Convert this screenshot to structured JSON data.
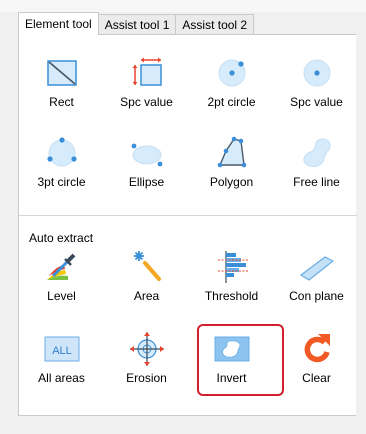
{
  "tabs": [
    "Element tool",
    "Assist tool 1",
    "Assist tool 2"
  ],
  "element_tools": [
    {
      "label": "Rect",
      "icon": "rect-icon"
    },
    {
      "label": "Spc value",
      "icon": "spc-value-rect-icon"
    },
    {
      "label": "2pt circle",
      "icon": "two-point-circle-icon"
    },
    {
      "label": "Spc value",
      "icon": "spc-value-circle-icon"
    },
    {
      "label": "3pt circle",
      "icon": "three-point-circle-icon"
    },
    {
      "label": "Ellipse",
      "icon": "ellipse-icon"
    },
    {
      "label": "Polygon",
      "icon": "polygon-icon"
    },
    {
      "label": "Free line",
      "icon": "free-line-icon"
    }
  ],
  "auto_extract": {
    "title": "Auto extract",
    "tools": [
      {
        "label": "Level",
        "icon": "level-eyedropper-icon"
      },
      {
        "label": "Area",
        "icon": "area-wand-icon"
      },
      {
        "label": "Threshold",
        "icon": "threshold-icon"
      },
      {
        "label": "Con plane",
        "icon": "con-plane-icon"
      },
      {
        "label": "All areas",
        "icon": "all-areas-icon",
        "icon_text": "ALL"
      },
      {
        "label": "Erosion",
        "icon": "erosion-icon"
      },
      {
        "label": "Invert",
        "icon": "invert-icon",
        "highlighted": true
      },
      {
        "label": "Clear",
        "icon": "clear-icon"
      }
    ]
  },
  "colors": {
    "icon_blue": "#3a8fd8",
    "icon_light": "#d6ebfb",
    "highlight": "#d2202f",
    "clear_orange": "#f15a24"
  }
}
